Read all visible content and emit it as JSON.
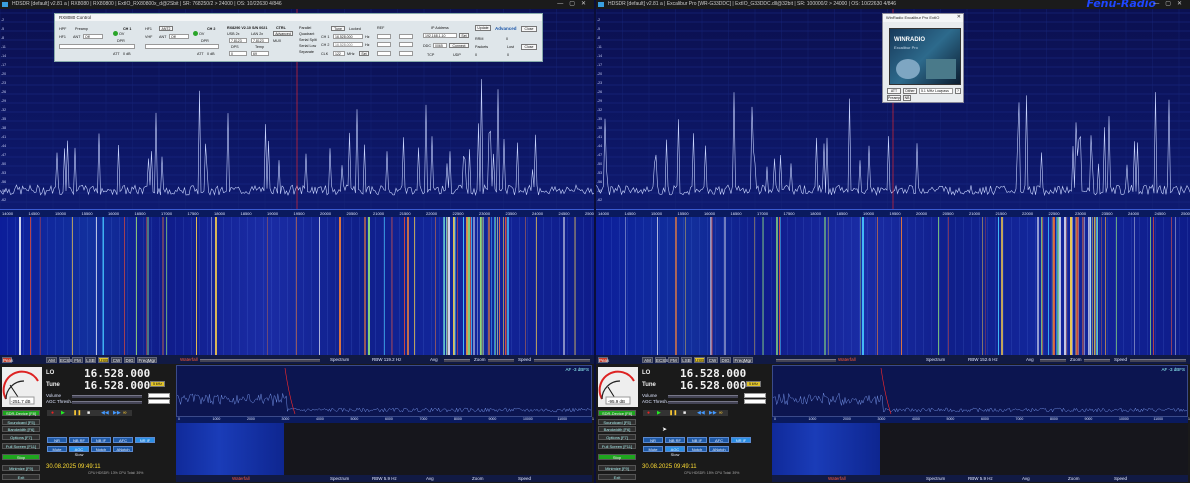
{
  "left": {
    "title": "HDSDR [default]  v2.81 a  |  RX8080 | RX80800  |  ExtIO_RX80800x_d@2Sbit  |  SR: 768250/2 > 24000  |  OS: 10/22630 4/846",
    "freq_ticks": [
      "14000",
      "14500",
      "15000",
      "15500",
      "16000",
      "16500",
      "17000",
      "17500",
      "18000",
      "18500",
      "19000",
      "19500",
      "20000",
      "20500",
      "21000",
      "21500",
      "22000",
      "22500",
      "23000",
      "23500",
      "24000",
      "24500",
      "25000"
    ],
    "modes": [
      "AM",
      "ECSS",
      "FM",
      "LSB",
      "USB",
      "CW",
      "DIG",
      "FreqMgr"
    ],
    "active_mode": "USB",
    "lo_label": "LO",
    "tune_label": "Tune",
    "lo_freq": "16.528.000",
    "tune_freq": "16.528.000",
    "volume_label": "Volume",
    "agc_label": "AGC Thresh.",
    "smeter_value": "-251.7 dB",
    "rbw": "RBW  119.2 Hz",
    "rbw_bottom": "RBW  5.9 Hz",
    "waterfall_label": "Waterfall",
    "spectrum_label": "Spectrum",
    "avg_label": "Avg",
    "zoom_label": "Zoom",
    "speed_label": "Speed",
    "date_time": "30.08.2025 09:49:11",
    "cpu": "CPU HDSDR:  13%    CPU Total:  39%",
    "af_label": "AF -3 dBFS",
    "side_buttons": [
      "SDR-Device [F8]",
      "Soundcard [F5]",
      "Bandwidth [F6]",
      "Options [F7]",
      "Full Screen [F11]",
      "Stop",
      "Minimize [F9]",
      "Exit"
    ],
    "agc_buttons": [
      "NR",
      "NB RF",
      "NB IF",
      "AFC",
      "NR IF"
    ],
    "agc_buttons2": [
      "Mute",
      "AGC Slow",
      "Notch",
      "ANotch"
    ],
    "audio_ticks": [
      "0",
      "1000",
      "2000",
      "3000",
      "4000",
      "5000",
      "6000",
      "7000",
      "8000",
      "9000",
      "10000",
      "11000",
      "12000"
    ],
    "panel": {
      "title": "RX8080 Control",
      "ch1": "CH 1",
      "ch2": "CH 2",
      "hpf": "HPF",
      "preamp": "Preamp",
      "hf1": "HF1",
      "vhf": "VHF",
      "ant": "ANT",
      "off": "Off",
      "ant2": "ANT2",
      "ov": "OV",
      "dpr": "DPR",
      "att": "ATT",
      "att_val": "0 dB",
      "rfsn": "RX8290 V2.10 S/N 0021",
      "ctrl": "CTRL",
      "adv": "Advanced",
      "usb": "USB 2x",
      "lan": "LAN 2x",
      "fw": "7.8123",
      "fw2": "7.8123",
      "mux": "MUX",
      "dps": "DPS",
      "temp": "Temp",
      "dps_val": "0",
      "temp_val": "69",
      "parallel": "Parallel",
      "quadrantsplit": "Quadrant",
      "serialsplit": "Serial Split",
      "seriallow": "Serial Low",
      "separate": "Separate",
      "tune": "Tune",
      "locked": "Locked",
      "ch1_freq": "16.528.000",
      "ch2_freq": "16.528.000",
      "hz": "Hz",
      "clk": "CLK",
      "clk_val": "122",
      "mhz": "MHz",
      "set": "Set",
      "ref": "REF",
      "ip_label": "IP Address",
      "ip": "192.168.1.10",
      "ddc": "DDC",
      "connect": "Connect",
      "tcp": "TCP",
      "udp": "UDP",
      "update": "Update",
      "advanced": "Advanced",
      "close": "Close",
      "rrm": "RRM",
      "packets": "Packets",
      "lost": "Lost",
      "zero": "0"
    }
  },
  "right": {
    "title": "HDSDR [default]  v2.81 a  |  Excalibur Pro [WR-G33DDC]  |  ExtIO_G33DDC.dll@32bit  |  SR: 100000/2 > 24000  |  OS: 10/22630 4/846",
    "brand": "Fenu-Radio",
    "freq_ticks": [
      "14000",
      "14500",
      "15000",
      "15500",
      "16000",
      "16500",
      "17000",
      "17500",
      "18000",
      "18500",
      "19000",
      "19500",
      "20000",
      "20500",
      "21000",
      "21500",
      "22000",
      "22500",
      "23000",
      "23500",
      "24000",
      "24500",
      "25000"
    ],
    "lo_freq": "16.528.000",
    "tune_freq": "16.528.000",
    "smeter_value": "-95.9 dB",
    "rbw": "RBW  152.6 Hz",
    "rbw_bottom": "RBW  5.9 Hz",
    "date_time": "30.08.2025 09:49:11",
    "cpu": "CPU HDSDR:  15%    CPU Total:  39%",
    "af_label": "AF -3 dBFS",
    "mini": {
      "title": "WinRadio Excalibur Pro ExtIO",
      "logo": "WINRADIO",
      "logo_sub": "Excalibur Pro",
      "att": "ATT",
      "dither": "Dither",
      "dropdown": "5.1 MHz Lowpass",
      "preamp": "Preamp",
      "nb": "NB",
      "q": "?"
    }
  },
  "colors": {
    "spectrum_bg": "#0b1050",
    "trace": "#c8d4ff",
    "marker": "#ff2a2a",
    "highlight": "#e0c32a",
    "brand": "#1e46ff"
  }
}
